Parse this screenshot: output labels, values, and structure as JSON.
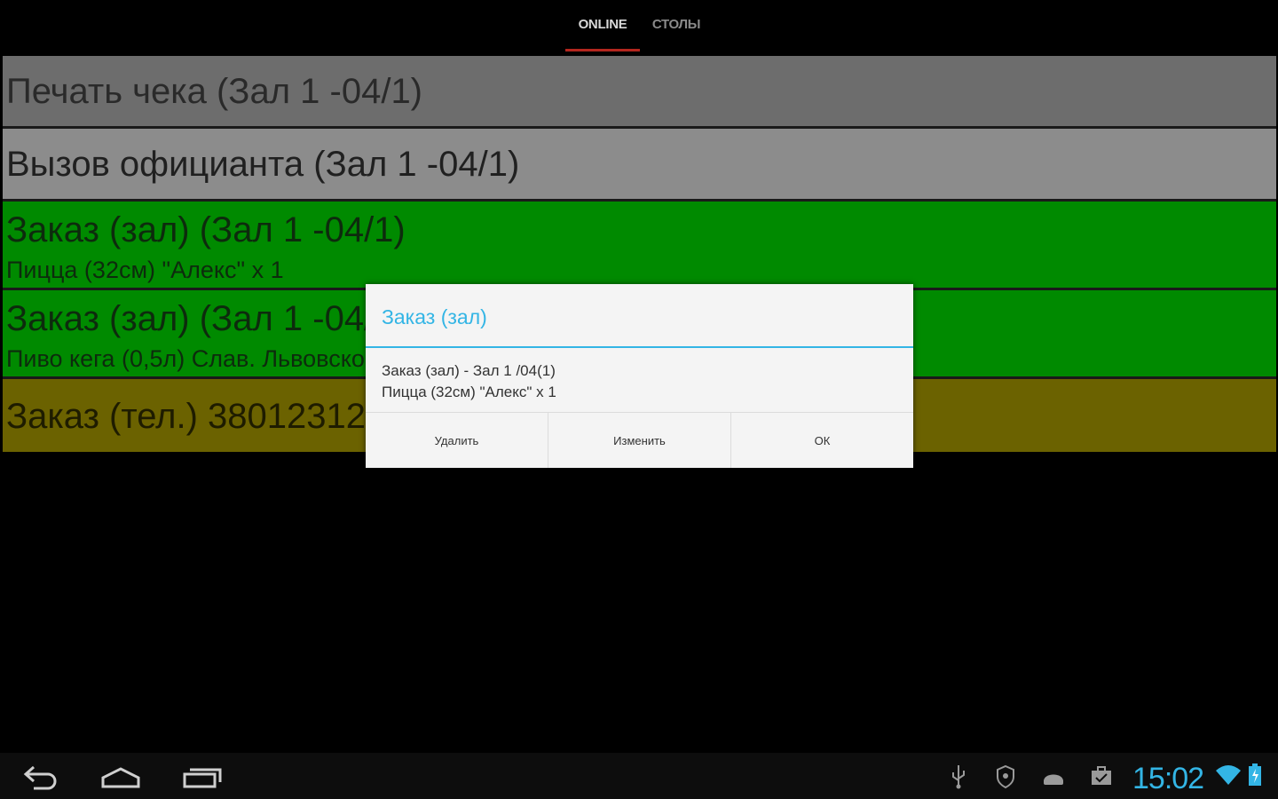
{
  "tabs": [
    {
      "label": "ONLINE",
      "active": true
    },
    {
      "label": "СТОЛЫ",
      "active": false
    }
  ],
  "list": [
    {
      "title": "Печать чека (Зал 1 -04/1)",
      "color": "#6d6d6d"
    },
    {
      "title": "Вызов официанта (Зал 1 -04/1)",
      "color": "#8c8c8c"
    },
    {
      "title": "Заказ (зал) (Зал 1 -04/1)",
      "subtitle": "Пицца (32см) \"Алекс\" х 1",
      "color": "#008a00"
    },
    {
      "title": "Заказ (зал) (Зал 1 -04/1)",
      "subtitle": "Пиво кега (0,5л) Слав. Львовское",
      "color": "#008a00"
    },
    {
      "title": "Заказ (тел.) 380123123",
      "color": "#6b6200"
    }
  ],
  "dialog": {
    "title": "Заказ (зал)",
    "message_line1": "Заказ (зал) - Зал 1 /04(1)",
    "message_line2": "Пицца (32см) \"Алекс\" х 1",
    "buttons": [
      "Удалить",
      "Изменить",
      "ОК"
    ],
    "accent_color": "#33b5e5"
  },
  "status_bar": {
    "time": "15:02",
    "icons": [
      "usb-icon",
      "shield-icon",
      "android-icon",
      "briefcase-icon",
      "wifi-icon",
      "battery-icon"
    ]
  },
  "navigation": [
    "back-icon",
    "home-icon",
    "recent-apps-icon"
  ]
}
